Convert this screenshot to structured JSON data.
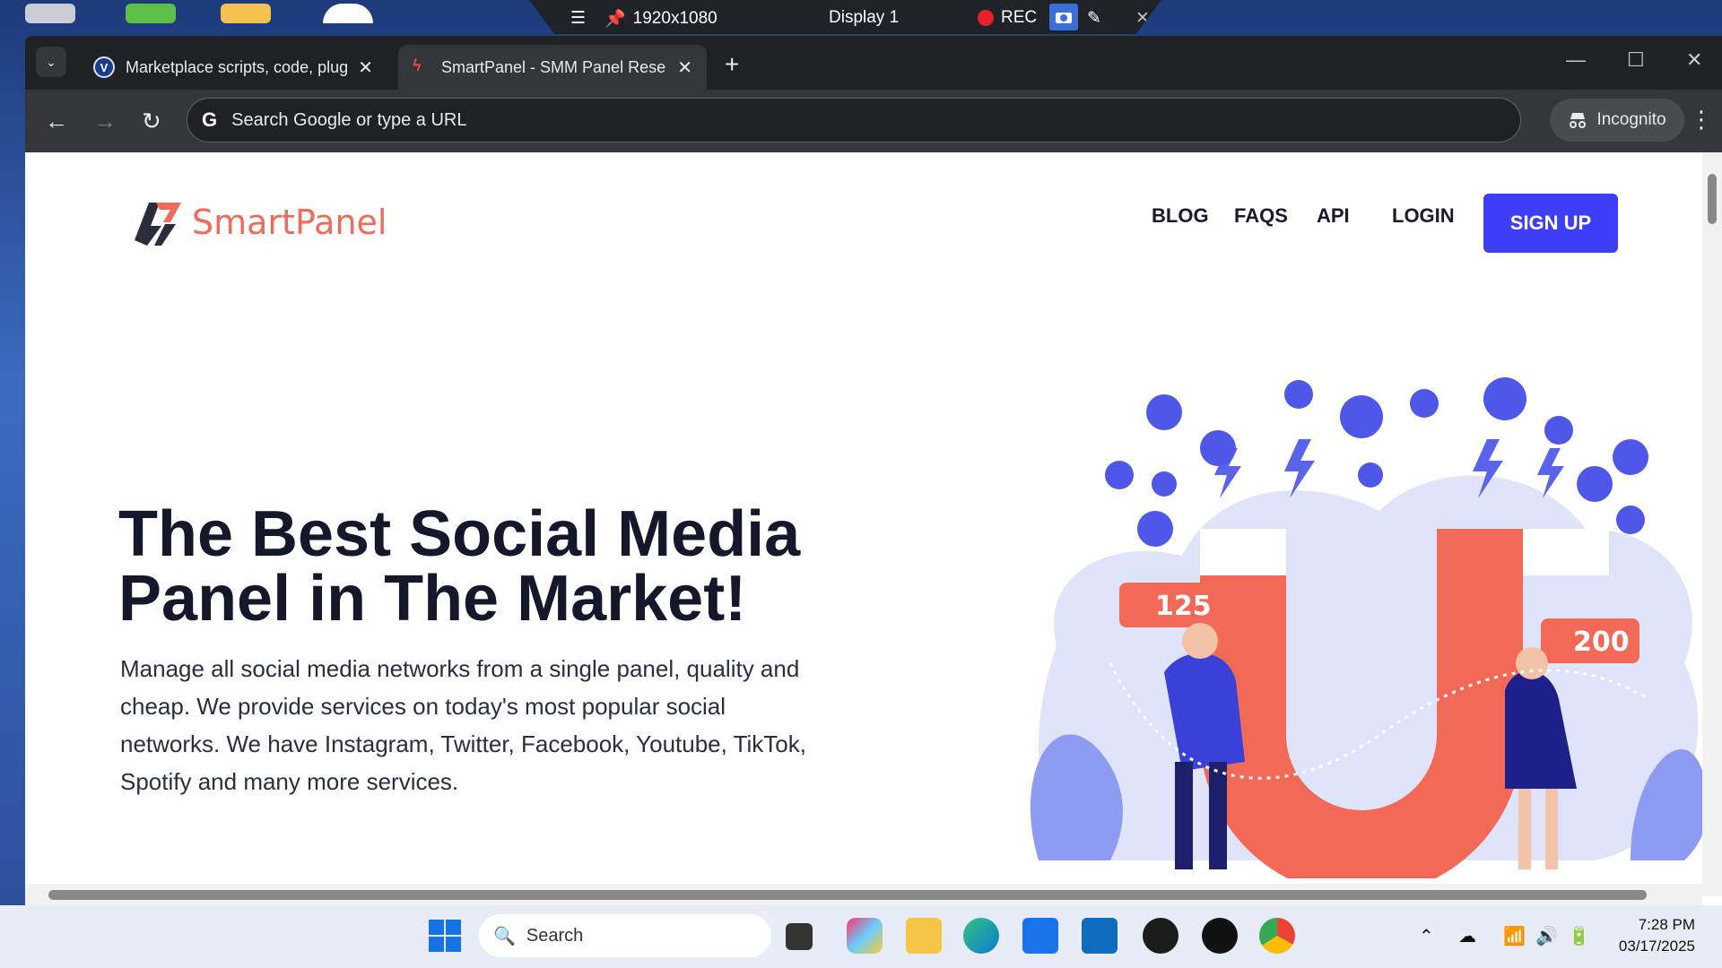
{
  "recorder": {
    "resolution": "1920x1080",
    "display": "Display 1",
    "rec_label": "REC"
  },
  "browser": {
    "tabs": [
      {
        "title": "Marketplace scripts, code, plugi",
        "favicon": "v-icon",
        "active": false
      },
      {
        "title": "SmartPanel - SMM Panel Resell",
        "favicon": "smartpanel-icon",
        "active": true
      }
    ],
    "omnibox_placeholder": "Search Google or type a URL",
    "incognito_label": "Incognito"
  },
  "site": {
    "brand": "SmartPanel",
    "nav": [
      "BLOG",
      "FAQS",
      "API",
      "LOGIN"
    ],
    "signup_label": "SIGN UP",
    "hero_title_line1": "The Best Social Media",
    "hero_title_line2": "Panel in The Market!",
    "hero_text": "Manage all social media networks from a single panel, quality and cheap. We provide services on today's most popular social networks. We have Instagram, Twitter, Facebook, Youtube, TikTok, Spotify and many more services.",
    "badge_left": "125",
    "badge_right": "200"
  },
  "taskbar": {
    "search_placeholder": "Search",
    "time": "7:28 PM",
    "date": "03/17/2025"
  },
  "colors": {
    "brand": "#ee6c59",
    "signup": "#3d3ef5",
    "illustration_blue": "#4f57e8",
    "illustration_red": "#f26957"
  }
}
